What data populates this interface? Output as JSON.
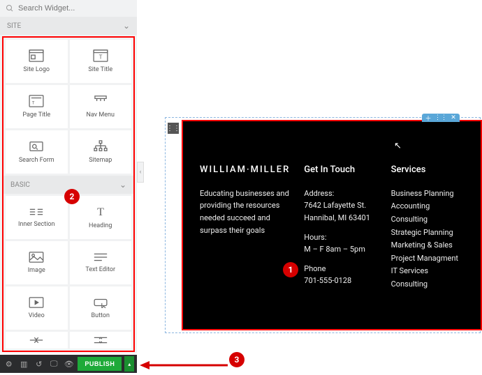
{
  "search": {
    "placeholder": "Search Widget..."
  },
  "sections": {
    "site": "SITE",
    "basic": "BASIC"
  },
  "widgets_site": [
    {
      "id": "site-logo",
      "label": "Site Logo"
    },
    {
      "id": "site-title",
      "label": "Site Title"
    },
    {
      "id": "page-title",
      "label": "Page Title"
    },
    {
      "id": "nav-menu",
      "label": "Nav Menu"
    },
    {
      "id": "search-form",
      "label": "Search Form"
    },
    {
      "id": "sitemap",
      "label": "Sitemap"
    }
  ],
  "widgets_basic": [
    {
      "id": "inner-section",
      "label": "Inner Section"
    },
    {
      "id": "heading",
      "label": "Heading"
    },
    {
      "id": "image",
      "label": "Image"
    },
    {
      "id": "text-editor",
      "label": "Text Editor"
    },
    {
      "id": "video",
      "label": "Video"
    },
    {
      "id": "button",
      "label": "Button"
    }
  ],
  "footer": {
    "brand": "WILLIAM·MILLER",
    "about": "Educating businesses and providing the resources needed succeed and surpass their goals",
    "touch_h": "Get In Touch",
    "address_label": "Address:",
    "address_line1": "7642 Lafayette St.",
    "address_line2": "Hannibal, MI 63401",
    "hours_label": "Hours:",
    "hours_value": "M – F 8am – 5pm",
    "phone_label": "Phone",
    "phone_value": "701-555-0128",
    "services_h": "Services",
    "services": [
      "Business Planning",
      "Accounting",
      "Consulting",
      "Strategic Planning",
      "Marketing & Sales",
      "Project Managment",
      "IT Services",
      "Consulting"
    ]
  },
  "publish": "PUBLISH",
  "annotations": {
    "a1": "1",
    "a2": "2",
    "a3": "3"
  }
}
